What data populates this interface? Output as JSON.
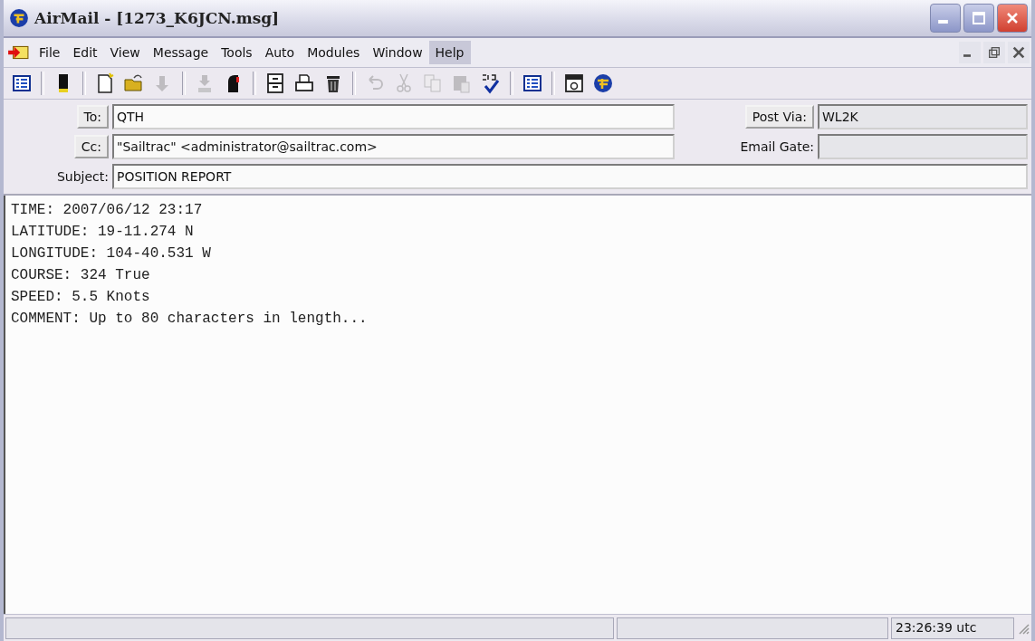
{
  "window": {
    "title": "AirMail - [1273_K6JCN.msg]"
  },
  "menu": [
    {
      "label": "File",
      "selected": false
    },
    {
      "label": "Edit",
      "selected": false
    },
    {
      "label": "View",
      "selected": false
    },
    {
      "label": "Message",
      "selected": false
    },
    {
      "label": "Tools",
      "selected": false
    },
    {
      "label": "Auto",
      "selected": false
    },
    {
      "label": "Modules",
      "selected": false
    },
    {
      "label": "Window",
      "selected": false
    },
    {
      "label": "Help",
      "selected": true
    }
  ],
  "toolbar": [
    {
      "kind": "pane",
      "disabled": false
    },
    {
      "kind": "sep"
    },
    {
      "kind": "book",
      "disabled": false
    },
    {
      "kind": "sep"
    },
    {
      "kind": "new",
      "disabled": false
    },
    {
      "kind": "open",
      "disabled": false
    },
    {
      "kind": "reply",
      "disabled": true
    },
    {
      "kind": "sep"
    },
    {
      "kind": "download",
      "disabled": true
    },
    {
      "kind": "mailbox",
      "disabled": false
    },
    {
      "kind": "sep"
    },
    {
      "kind": "cabinet",
      "disabled": false
    },
    {
      "kind": "print",
      "disabled": false
    },
    {
      "kind": "trash",
      "disabled": false
    },
    {
      "kind": "sep"
    },
    {
      "kind": "undo",
      "disabled": true
    },
    {
      "kind": "cut",
      "disabled": true
    },
    {
      "kind": "copy",
      "disabled": true
    },
    {
      "kind": "paste",
      "disabled": true
    },
    {
      "kind": "spell",
      "disabled": false
    },
    {
      "kind": "sep"
    },
    {
      "kind": "pane",
      "disabled": false
    },
    {
      "kind": "sep"
    },
    {
      "kind": "modem",
      "disabled": false
    },
    {
      "kind": "globe",
      "disabled": false
    }
  ],
  "header": {
    "to": {
      "label": "To:",
      "value": "QTH"
    },
    "cc": {
      "label": "Cc:",
      "value": "\"Sailtrac\" <administrator@sailtrac.com>"
    },
    "subject": {
      "label": "Subject:",
      "value": "POSITION REPORT"
    },
    "post_via": {
      "label": "Post Via:",
      "value": "WL2K"
    },
    "email_gate": {
      "label": "Email Gate:"
    }
  },
  "body": [
    "TIME: 2007/06/12 23:17",
    "LATITUDE: 19-11.274 N",
    "LONGITUDE: 104-40.531 W",
    "COURSE: 324 True",
    "SPEED: 5.5 Knots",
    "COMMENT: Up to 80 characters in length..."
  ],
  "status_bar": {
    "time": "23:26:39 utc"
  }
}
